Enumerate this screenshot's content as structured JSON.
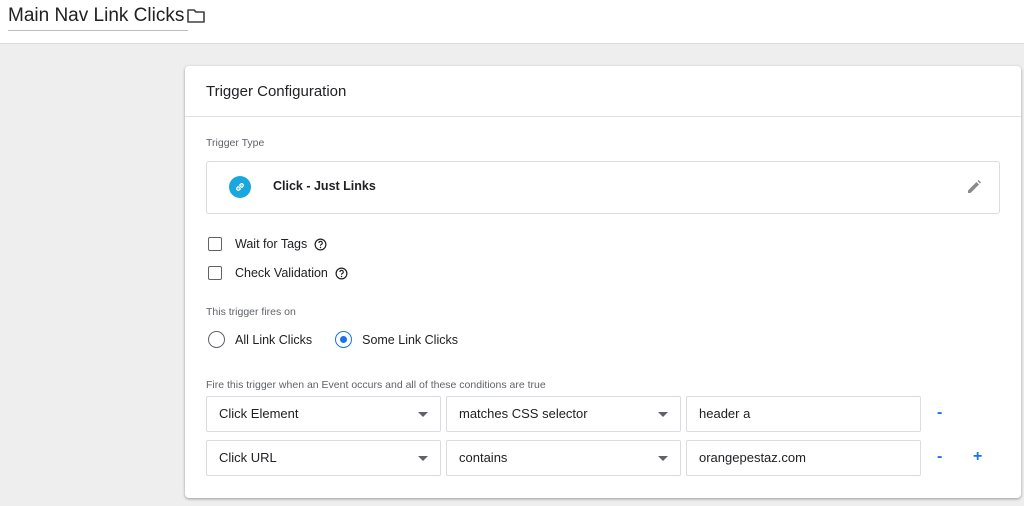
{
  "page": {
    "title": "Main Nav Link Clicks",
    "folder_icon": "folder-icon"
  },
  "card": {
    "header": "Trigger Configuration",
    "trigger_type_label": "Trigger Type",
    "trigger_type": {
      "name": "Click - Just Links",
      "icon": "link-icon",
      "icon_color": "#19a7e0",
      "edit_icon": "pencil-icon"
    },
    "options": [
      {
        "label": "Wait for Tags",
        "checked": false
      },
      {
        "label": "Check Validation",
        "checked": false
      }
    ],
    "fires_on_label": "This trigger fires on",
    "fires_on": [
      {
        "label": "All Link Clicks",
        "selected": false
      },
      {
        "label": "Some Link Clicks",
        "selected": true
      }
    ],
    "conditions_label": "Fire this trigger when an Event occurs and all of these conditions are true",
    "conditions": [
      {
        "variable": "Click Element",
        "operator": "matches CSS selector",
        "value": "header a",
        "remove": "-",
        "add": ""
      },
      {
        "variable": "Click URL",
        "operator": "contains",
        "value": "orangepestaz.com",
        "remove": "-",
        "add": "+"
      }
    ]
  },
  "colors": {
    "accent": "#1a73e8",
    "background": "#eeeeee"
  }
}
